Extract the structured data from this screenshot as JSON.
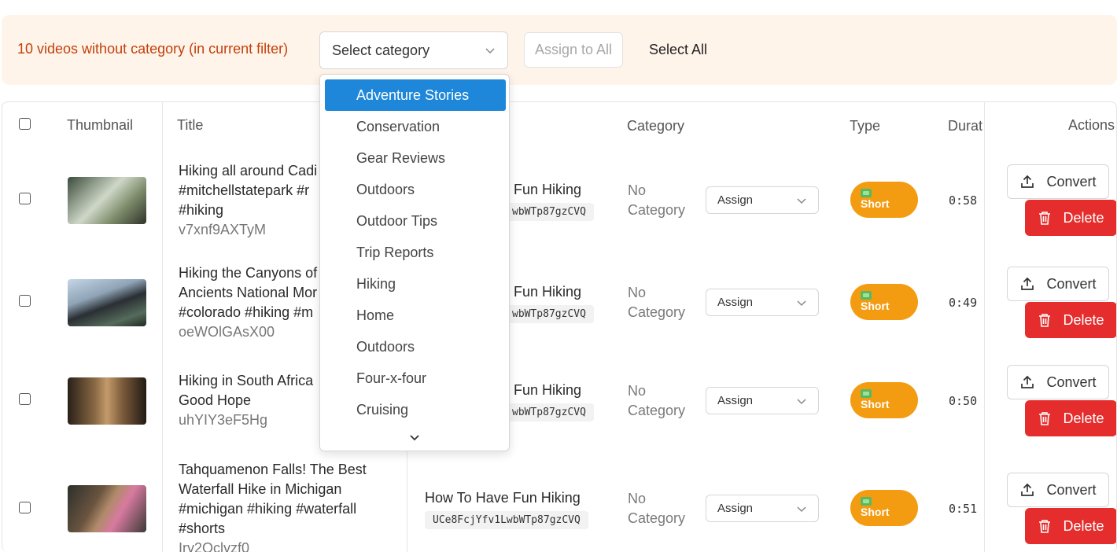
{
  "banner": {
    "text": "10 videos without category (in current filter)",
    "select_placeholder": "Select category",
    "assign_all_label": "Assign to All",
    "select_all_label": "Select All"
  },
  "table": {
    "headers": {
      "thumbnail": "Thumbnail",
      "title": "Title",
      "category": "Category",
      "type": "Type",
      "duration": "Durat",
      "actions": "Actions"
    },
    "rows": [
      {
        "title_lines": [
          "Hiking all around Cadi",
          "#mitchellstatepark #r",
          "#hiking"
        ],
        "video_id": "v7xnf9AXTyM",
        "channel": "Fun Hiking",
        "channel_id": "wbWTp87gzCVQ",
        "category": "No Category",
        "assign_label": "Assign",
        "type": "Short",
        "duration": "0:58",
        "convert_label": "Convert",
        "delete_label": "Delete"
      },
      {
        "title_lines": [
          "Hiking the Canyons of",
          "Ancients National Mor",
          "#colorado #hiking #m"
        ],
        "video_id": "oeWOlGAsX00",
        "channel": "Fun Hiking",
        "channel_id": "wbWTp87gzCVQ",
        "category": "No Category",
        "assign_label": "Assign",
        "type": "Short",
        "duration": "0:49",
        "convert_label": "Convert",
        "delete_label": "Delete"
      },
      {
        "title_lines": [
          "Hiking in South Africa",
          "Good Hope"
        ],
        "video_id": "uhYIY3eF5Hg",
        "channel": "Fun Hiking",
        "channel_id": "wbWTp87gzCVQ",
        "category": "No Category",
        "assign_label": "Assign",
        "type": "Short",
        "duration": "0:50",
        "convert_label": "Convert",
        "delete_label": "Delete"
      },
      {
        "title_lines": [
          "Tahquamenon Falls! The Best",
          "Waterfall Hike in Michigan",
          "#michigan #hiking #waterfall",
          "#shorts"
        ],
        "video_id": "Iry2Oclyzf0",
        "channel": "How To Have Fun Hiking",
        "channel_id": "UCe8FcjYfv1LwbWTp87gzCVQ",
        "category": "No Category",
        "assign_label": "Assign",
        "type": "Short",
        "duration": "0:51",
        "convert_label": "Convert",
        "delete_label": "Delete"
      }
    ]
  },
  "dropdown": {
    "options": [
      "Adventure Stories",
      "Conservation",
      "Gear Reviews",
      "Outdoors",
      "Outdoor Tips",
      "Trip Reports",
      "Hiking",
      "Home",
      "Outdoors",
      "Four-x-four",
      "Cruising"
    ],
    "highlighted": "Adventure Stories"
  },
  "colors": {
    "banner_bg": "#fff4ea",
    "banner_text": "#c2410c",
    "dropdown_highlight": "#1e87d9",
    "type_badge": "#f39c12",
    "delete_button": "#e52d2d"
  },
  "icons": {
    "chevron": "chevron-down-icon",
    "upload": "upload-icon",
    "trash": "trash-icon",
    "short": "short-video-icon"
  }
}
